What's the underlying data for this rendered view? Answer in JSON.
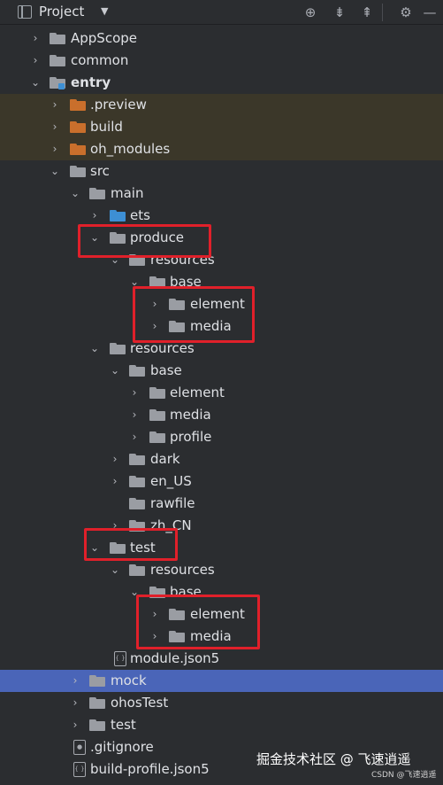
{
  "header": {
    "title": "Project",
    "icons": [
      "target-icon",
      "collapse-all-icon",
      "expand-all-icon",
      "settings-icon"
    ]
  },
  "tree": {
    "appscope": "AppScope",
    "common": "common",
    "entry": "entry",
    "preview": ".preview",
    "build": "build",
    "oh_modules": "oh_modules",
    "src": "src",
    "main": "main",
    "ets": "ets",
    "produce": "produce",
    "produce_resources": "resources",
    "produce_base": "base",
    "produce_element": "element",
    "produce_media": "media",
    "main_resources": "resources",
    "main_base": "base",
    "main_element": "element",
    "main_media": "media",
    "main_profile": "profile",
    "dark": "dark",
    "en_us": "en_US",
    "rawfile": "rawfile",
    "zh_cn": "zh_CN",
    "test": "test",
    "test_resources": "resources",
    "test_base": "base",
    "test_element": "element",
    "test_media": "media",
    "module_json5": "module.json5",
    "mock": "mock",
    "ohostest": "ohosTest",
    "src_test": "test",
    "gitignore": ".gitignore",
    "build_profile": "build-profile.json5"
  },
  "watermark": {
    "text": "掘金技术社区 @ 飞速逍遥",
    "small": "CSDN @飞速逍遥"
  },
  "colors": {
    "background": "#2b2d30",
    "excluded_row": "#3b3729",
    "selected_row": "#4a65b8",
    "highlight_box": "#e0202a",
    "folder_orange": "#c96f2c",
    "folder_blue": "#3d8fd4"
  }
}
